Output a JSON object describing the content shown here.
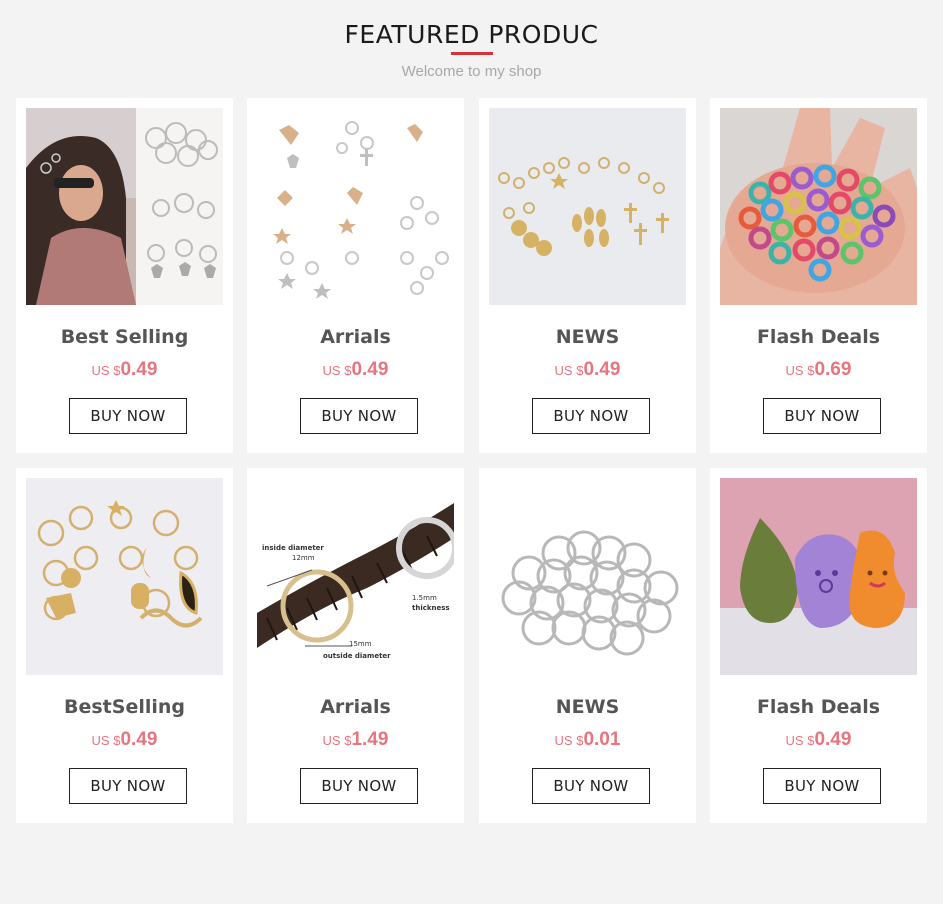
{
  "header": {
    "title": "FEATURED PRODUC",
    "subtitle": "Welcome to my shop",
    "accent_color": "#d6323a"
  },
  "price_color": "#e8747f",
  "products": [
    {
      "name": "Best Selling",
      "currency": "US $",
      "price": "0.49",
      "button": "BUY NOW"
    },
    {
      "name": "Arrials",
      "currency": "US $",
      "price": "0.49",
      "button": "BUY NOW"
    },
    {
      "name": "NEWS",
      "currency": "US $",
      "price": "0.49",
      "button": "BUY NOW"
    },
    {
      "name": "Flash Deals",
      "currency": "US $",
      "price": "0.69",
      "button": "BUY NOW"
    },
    {
      "name": "BestSelling",
      "currency": "US $",
      "price": "0.49",
      "button": "BUY NOW"
    },
    {
      "name": "Arrials",
      "currency": "US $",
      "price": "1.49",
      "button": "BUY NOW",
      "image_labels": [
        "inside diameter",
        "12mm",
        "1.5mm",
        "thickness",
        "15mm",
        "outside diameter"
      ]
    },
    {
      "name": "NEWS",
      "currency": "US $",
      "price": "0.01",
      "button": "BUY NOW"
    },
    {
      "name": "Flash Deals",
      "currency": "US $",
      "price": "0.49",
      "button": "BUY NOW"
    }
  ]
}
